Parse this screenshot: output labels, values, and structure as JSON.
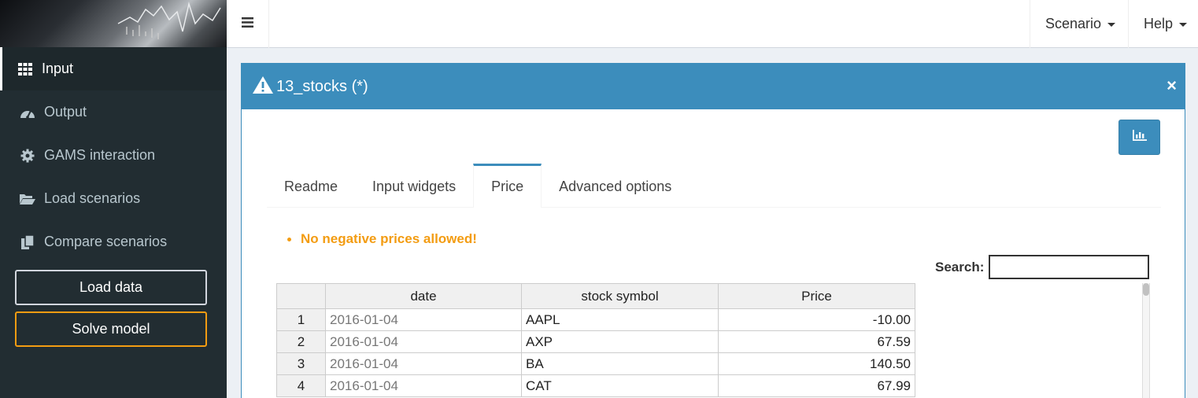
{
  "sidebar": {
    "items": [
      {
        "label": "Input",
        "icon": "grid-icon",
        "active": true
      },
      {
        "label": "Output",
        "icon": "dashboard-icon",
        "active": false
      },
      {
        "label": "GAMS interaction",
        "icon": "gear-icon",
        "active": false
      },
      {
        "label": "Load scenarios",
        "icon": "folder-open-icon",
        "active": false
      },
      {
        "label": "Compare scenarios",
        "icon": "copy-icon",
        "active": false
      }
    ],
    "load_button": "Load data",
    "solve_button": "Solve model"
  },
  "header": {
    "menu_scenario": "Scenario",
    "menu_help": "Help"
  },
  "box": {
    "title": "13_stocks (*)",
    "close": "×"
  },
  "tabs": [
    "Readme",
    "Input widgets",
    "Price",
    "Advanced options"
  ],
  "active_tab": "Price",
  "warning": "No negative prices allowed!",
  "search": {
    "label": "Search:",
    "value": ""
  },
  "table": {
    "columns": [
      "date",
      "stock symbol",
      "Price"
    ],
    "rows": [
      {
        "idx": "1",
        "date": "2016-01-04",
        "symbol": "AAPL",
        "price": "-10.00"
      },
      {
        "idx": "2",
        "date": "2016-01-04",
        "symbol": "AXP",
        "price": "67.59"
      },
      {
        "idx": "3",
        "date": "2016-01-04",
        "symbol": "BA",
        "price": "140.50"
      },
      {
        "idx": "4",
        "date": "2016-01-04",
        "symbol": "CAT",
        "price": "67.99"
      }
    ]
  },
  "colors": {
    "sidebar_bg": "#222d32",
    "primary": "#3c8dbc",
    "warning": "#f39c12"
  }
}
